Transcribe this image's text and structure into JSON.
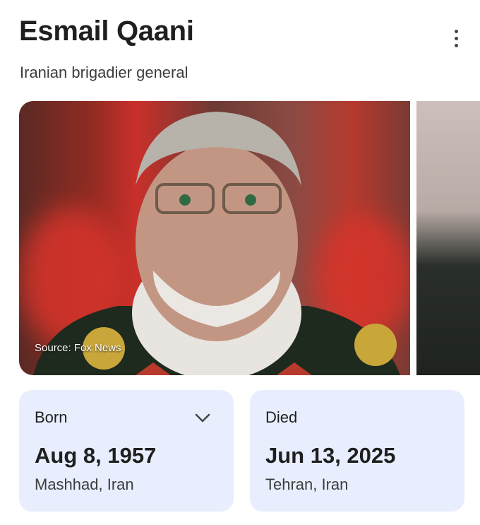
{
  "header": {
    "title": "Esmail Qaani",
    "subtitle": "Iranian brigadier general",
    "more_icon": "more-vert-icon"
  },
  "gallery": {
    "source_caption": "Source: Fox News"
  },
  "facts": {
    "born": {
      "label": "Born",
      "date": "Aug 8, 1957",
      "place": "Mashhad, Iran",
      "icon": "chevron-down-icon"
    },
    "died": {
      "label": "Died",
      "date": "Jun 13, 2025",
      "place": "Tehran, Iran"
    }
  },
  "colors": {
    "card_bg": "#e8eefd",
    "text_primary": "#1f1f1f",
    "text_secondary": "#3c3c3c"
  }
}
